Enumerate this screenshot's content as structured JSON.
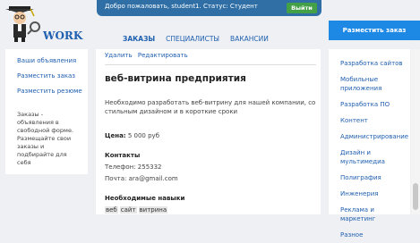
{
  "brand": {
    "name": "WORK"
  },
  "topbar": {
    "greeting": "Добро пожаловать, student1. Статус: Студент",
    "logout_label": "Выйти"
  },
  "post_button": "Разместить заказ",
  "tabs": [
    {
      "label": "ЗАКАЗЫ"
    },
    {
      "label": "СПЕЦИАЛИСТЫ"
    },
    {
      "label": "ВАКАНСИИ"
    }
  ],
  "left_nav": {
    "items": [
      "Ваши объявления",
      "Разместить заказ",
      "Разместить резюме"
    ],
    "info": "Заказы - объявления в свободной форме. Размещайте свои заказы и подбирайте для себя"
  },
  "order": {
    "actions": [
      "Удалить",
      "Редактировать"
    ],
    "title": "веб-витрина предприятия",
    "description": "Необходимо разработать веб-витрину для нашей компании, со стильным дизайном и в короткие сроки",
    "price_label": "Цена:",
    "price_value": "5 000 руб",
    "contacts_heading": "Контакты",
    "phone": "Телефон: 255332",
    "email": "Почта: ara@gmail.com",
    "skills_heading": "Необходимые навыки",
    "skills": [
      "веб",
      "сайт",
      "витрина"
    ]
  },
  "categories": [
    "Разработка сайтов",
    "Мобильные приложения",
    "Разработка ПО",
    "Контент",
    "Администрирование",
    "Дизайн и мультимедиа",
    "Полиграфия",
    "Инженерия",
    "Реклама и маркетинг",
    "Разное"
  ]
}
